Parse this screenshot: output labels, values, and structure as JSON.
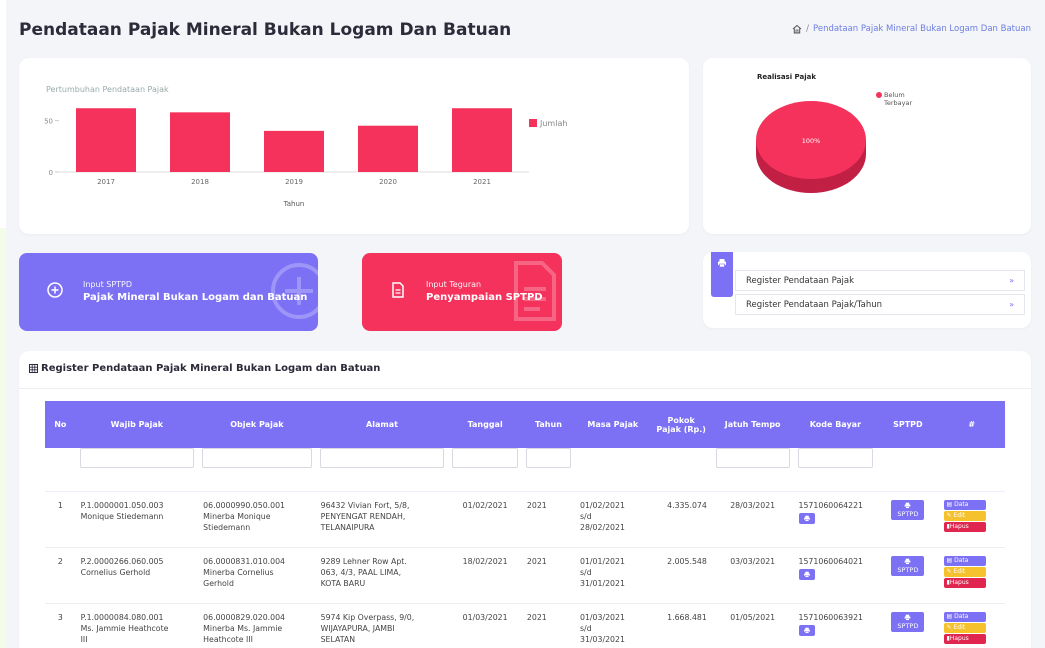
{
  "page": {
    "title": "Pendataan Pajak Mineral Bukan Logam Dan Batuan",
    "breadcrumb_sep": "/",
    "breadcrumb_current": "Pendataan Pajak Mineral Bukan Logam Dan Batuan"
  },
  "chart_data": [
    {
      "type": "bar",
      "title": "Pertumbuhan Pendataan Pajak",
      "categories": [
        "2017",
        "2018",
        "2019",
        "2020",
        "2021"
      ],
      "series": [
        {
          "name": "Jumlah",
          "values": [
            62,
            58,
            40,
            45,
            62
          ]
        }
      ],
      "xlabel": "Tahun",
      "ylabel": "",
      "yticks": [
        "0",
        "50"
      ],
      "ylim": [
        0,
        70
      ],
      "legend": "right",
      "color": "#f5325c"
    },
    {
      "type": "pie",
      "title": "Realisasi Pajak",
      "slices": [
        {
          "name": "Belum Terbayar",
          "value": 100,
          "label": "100%"
        }
      ],
      "legend": "top-right",
      "color": "#f5325c"
    }
  ],
  "legend_pie": {
    "line1": "Belum",
    "line2": "Terbayar"
  },
  "actions": {
    "sptpd": {
      "small": "Input SPTPD",
      "big": "Pajak Mineral Bukan Logam dan Batuan"
    },
    "teguran": {
      "small": "Input Teguran",
      "big": "Penyampaian SPTPD"
    }
  },
  "register": {
    "items": [
      {
        "label": "Register Pendataan Pajak",
        "chev": "»"
      },
      {
        "label": "Register Pendataan Pajak/Tahun",
        "chev": "»"
      }
    ]
  },
  "table": {
    "title": "Register Pendataan Pajak Mineral Bukan Logam dan Batuan",
    "headers": [
      "No",
      "Wajib Pajak",
      "Objek Pajak",
      "Alamat",
      "Tanggal",
      "Tahun",
      "Masa Pajak",
      "Pokok Pajak (Rp.)",
      "Jatuh Tempo",
      "Kode Bayar",
      "SPTPD",
      "#"
    ],
    "rows": [
      {
        "no": "1",
        "wp1": "P.1.0000001.050.003",
        "wp2": "Monique Stiedemann",
        "op1": "06.0000990.050.001",
        "op2": "Minerba Monique",
        "op3": "Stiedemann",
        "al1": "96432 Vivian Fort, 5/8,",
        "al2": "PENYENGAT RENDAH,",
        "al3": "TELANAIPURA",
        "tanggal": "01/02/2021",
        "tahun": "2021",
        "m1": "01/02/2021",
        "m2": "s/d",
        "m3": "28/02/2021",
        "pokok": "4.335.074",
        "jatuh": "28/03/2021",
        "kode": "1571060064221"
      },
      {
        "no": "2",
        "wp1": "P.2.0000266.060.005",
        "wp2": "Cornelius Gerhold",
        "op1": "06.0000831.010.004",
        "op2": "Minerba Cornelius",
        "op3": "Gerhold",
        "al1": "9289 Lehner Row Apt.",
        "al2": "063, 4/3, PAAL LIMA,",
        "al3": "KOTA BARU",
        "tanggal": "18/02/2021",
        "tahun": "2021",
        "m1": "01/01/2021",
        "m2": "s/d",
        "m3": "31/01/2021",
        "pokok": "2.005.548",
        "jatuh": "03/03/2021",
        "kode": "1571060064021"
      },
      {
        "no": "3",
        "wp1": "P.1.0000084.080.001",
        "wp2": "Ms. Jammie Heathcote",
        "wp3": "III",
        "op1": "06.0000829.020.004",
        "op2": "Minerba Ms. Jammie",
        "op3": "Heathcote III",
        "al1": "5974 Kip Overpass, 9/0,",
        "al2": "WIJAYAPURA, JAMBI",
        "al3": "SELATAN",
        "tanggal": "01/03/2021",
        "tahun": "2021",
        "m1": "01/03/2021",
        "m2": "s/d",
        "m3": "31/03/2021",
        "pokok": "1.668.481",
        "jatuh": "01/05/2021",
        "kode": "1571060063921"
      }
    ],
    "btn_sptpd": "SPTPD",
    "btn_data": "Data",
    "btn_edit": "Edit",
    "btn_hapus": "Hapus"
  }
}
